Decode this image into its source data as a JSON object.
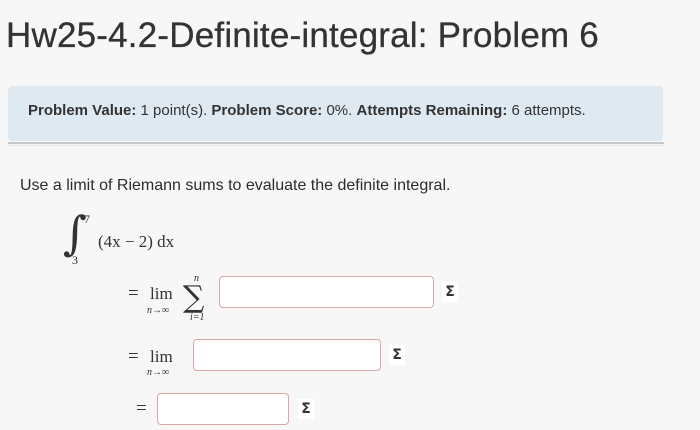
{
  "page_title": "Hw25-4.2-Definite-integral: Problem 6",
  "info": {
    "value_label": "Problem Value:",
    "value": "1 point(s).",
    "score_label": "Problem Score:",
    "score": "0%.",
    "attempts_label": "Attempts Remaining:",
    "attempts": "6 attempts."
  },
  "problem": {
    "prompt": "Use a limit of Riemann sums to evaluate the definite integral.",
    "integral_sign": "∫",
    "upper_limit": "7",
    "lower_limit": "3",
    "integrand": "(4x − 2) dx",
    "eq": "=",
    "lim": "lim",
    "lim_sub": "n→∞",
    "sigma": "∑",
    "sigma_top": "n",
    "sigma_bottom": "i=1"
  },
  "answers": [
    {
      "value": "",
      "sigma_label": "Σ"
    },
    {
      "value": "",
      "sigma_label": "Σ"
    },
    {
      "value": "",
      "sigma_label": "Σ"
    }
  ]
}
